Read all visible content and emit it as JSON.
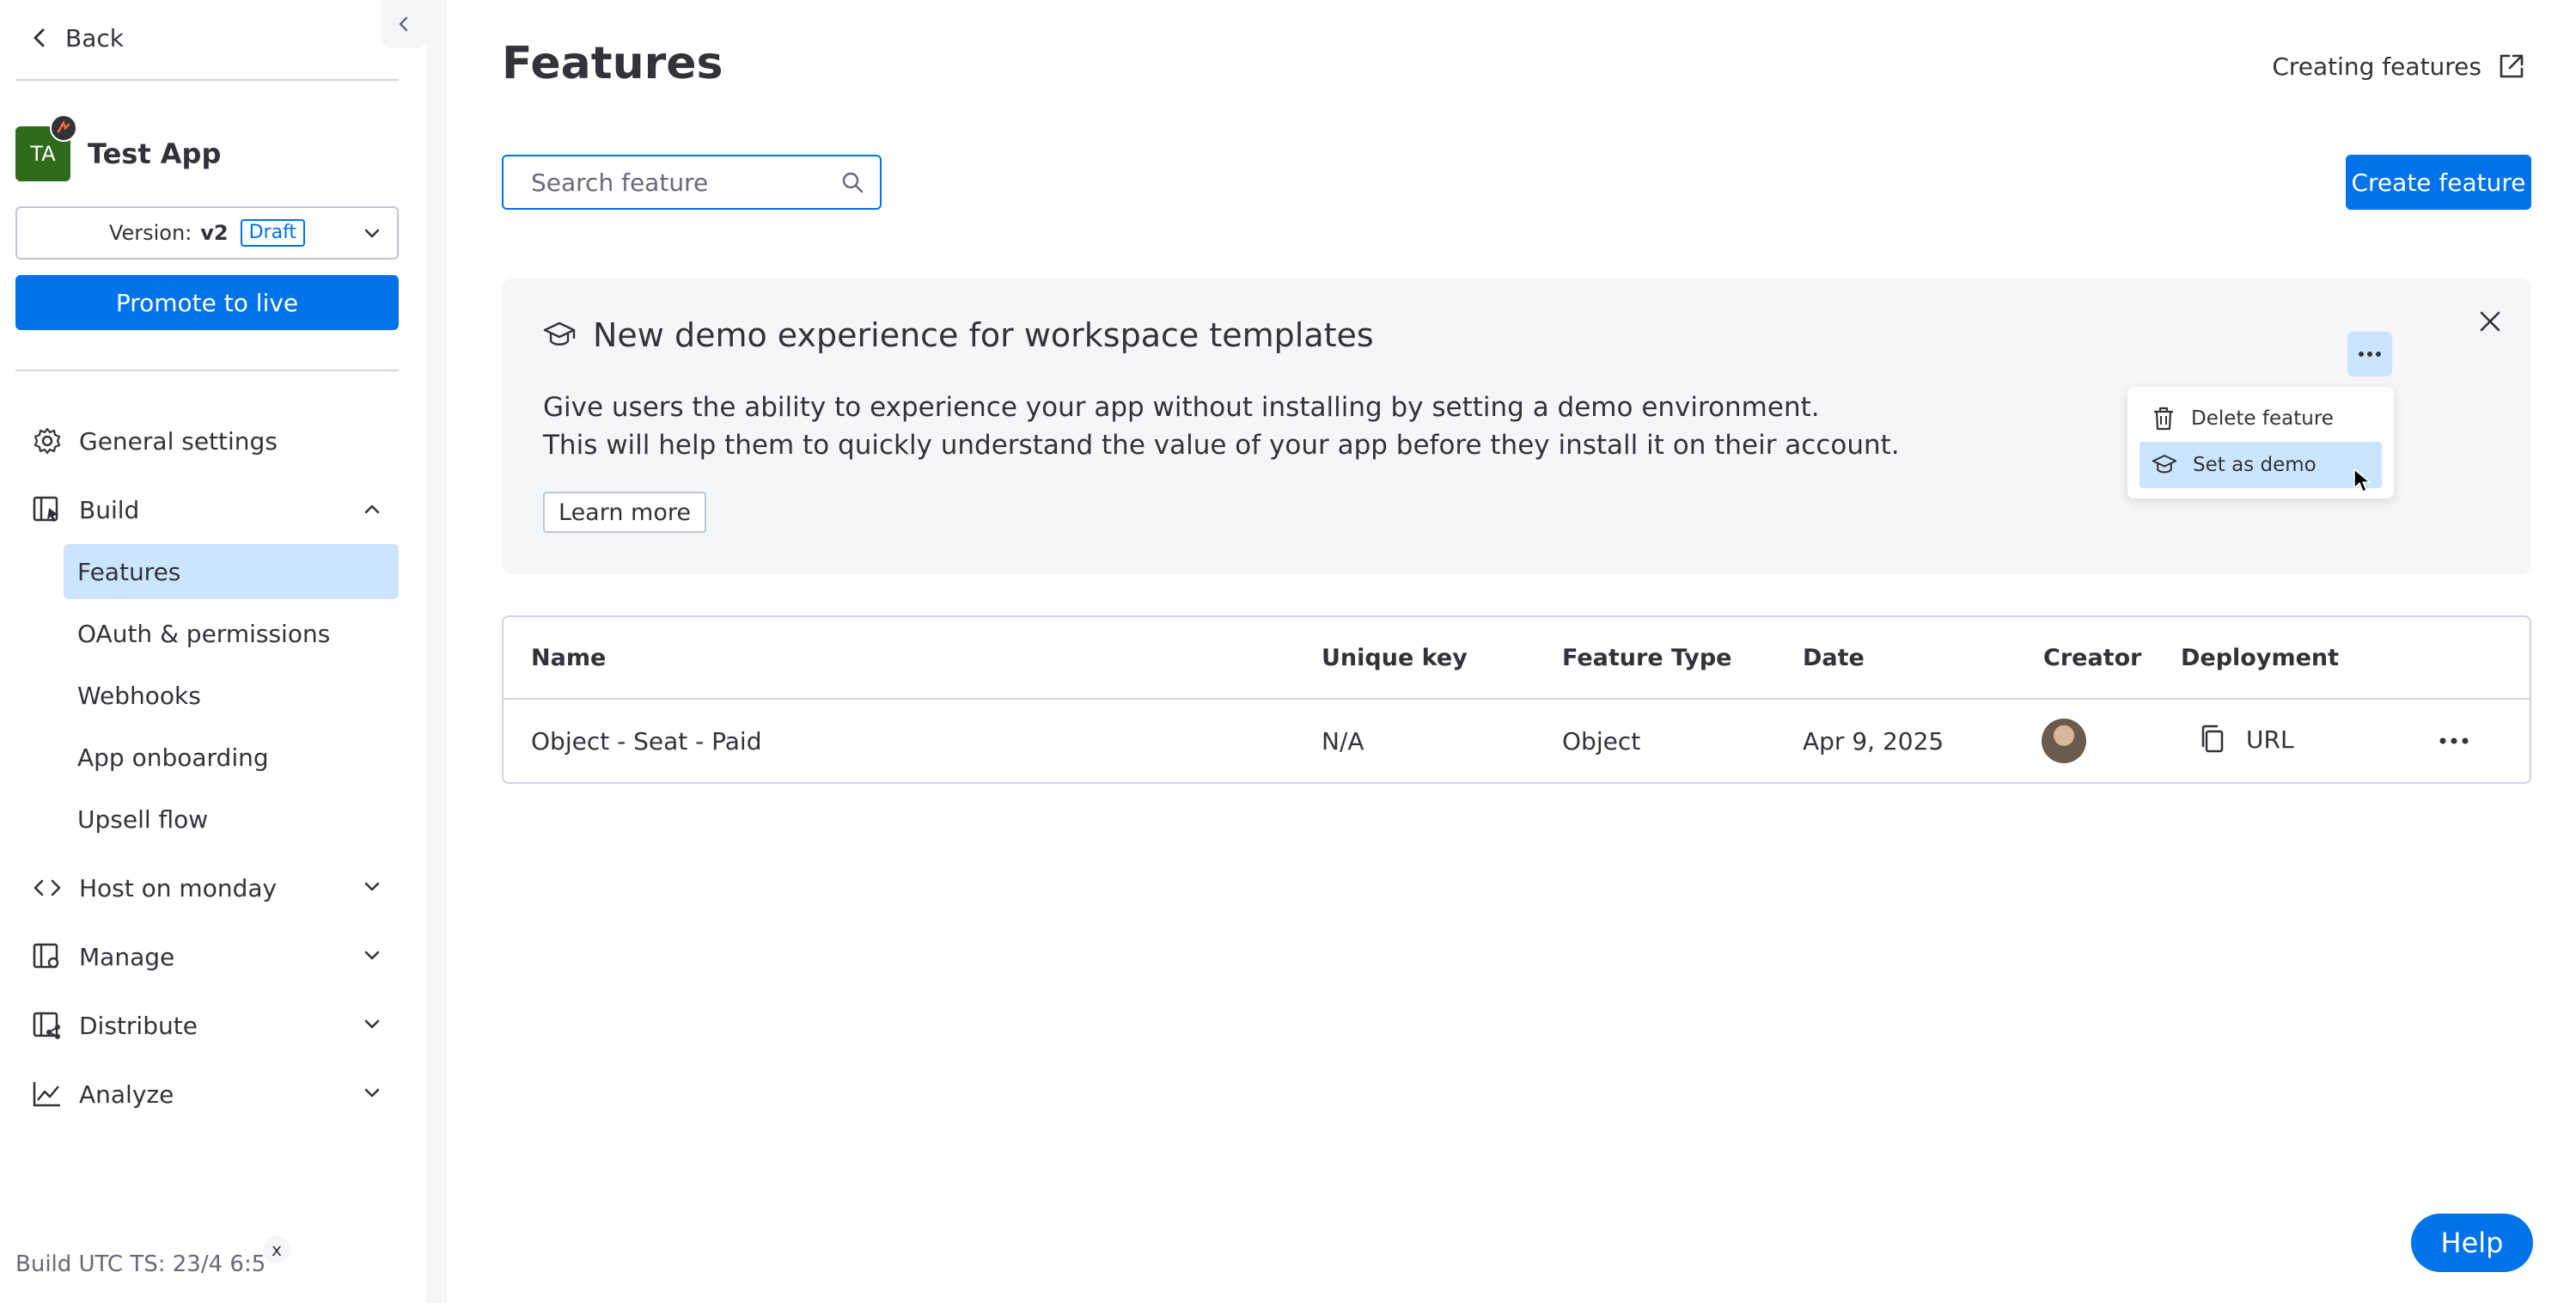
{
  "sidebar": {
    "back_label": "Back",
    "app": {
      "initials": "TA",
      "name": "Test App"
    },
    "version": {
      "label": "Version:",
      "value": "v2",
      "status": "Draft"
    },
    "promote_label": "Promote to live",
    "nav": {
      "general_settings": "General settings",
      "build": "Build",
      "build_items": [
        "Features",
        "OAuth & permissions",
        "Webhooks",
        "App onboarding",
        "Upsell flow"
      ],
      "host": "Host on monday",
      "manage": "Manage",
      "distribute": "Distribute",
      "analyze": "Analyze"
    },
    "build_ts": "Build UTC TS: 23/4 6:5",
    "build_ts_close": "x"
  },
  "main": {
    "title": "Features",
    "help_link": "Creating features",
    "search": {
      "placeholder": "Search feature",
      "value": ""
    },
    "create_button": "Create feature",
    "banner": {
      "title": "New demo experience for workspace templates",
      "line1": "Give users the ability to experience your app without installing by setting a demo environment.",
      "line2": "This will help them to quickly understand the value of your app before they install it on their account.",
      "learn_more": "Learn more",
      "menu": {
        "delete": "Delete feature",
        "set_demo": "Set as demo"
      }
    },
    "table": {
      "columns": [
        "Name",
        "Unique key",
        "Feature Type",
        "Date",
        "Creator",
        "Deployment"
      ],
      "rows": [
        {
          "name": "Object - Seat - Paid",
          "unique_key": "N/A",
          "feature_type": "Object",
          "date": "Apr 9, 2025",
          "deployment": "URL"
        }
      ]
    }
  },
  "help_button": "Help",
  "colors": {
    "accent": "#0073ea",
    "accent_light": "#cce5ff",
    "text": "#323338",
    "muted": "#676879",
    "banner_bg": "#f5f6f8",
    "app_avatar": "#2e6b1a"
  }
}
